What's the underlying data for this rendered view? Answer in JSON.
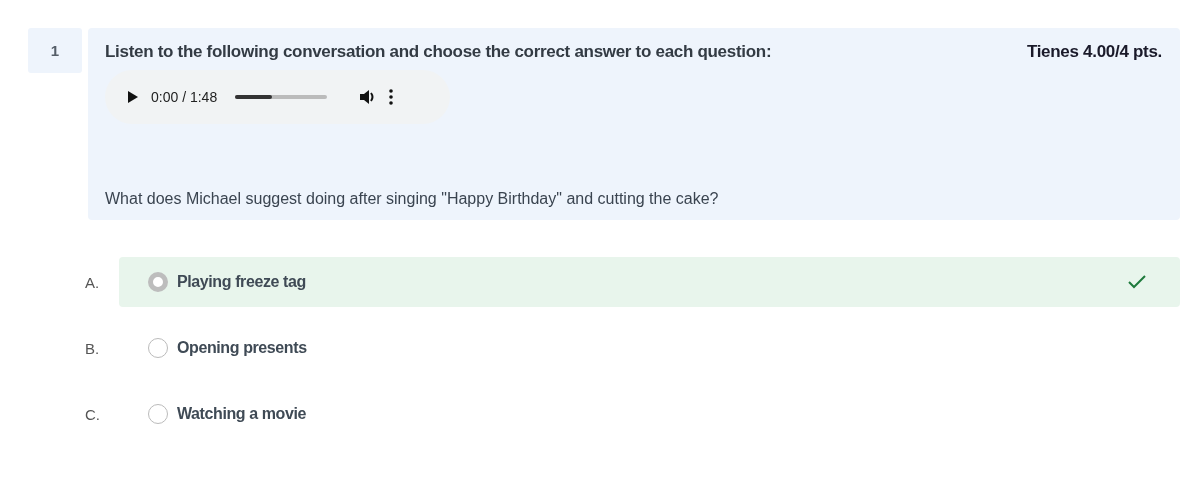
{
  "question": {
    "number": "1",
    "instruction": "Listen to the following conversation and choose the correct answer to each question:",
    "score": "Tienes 4.00/4 pts.",
    "audio": {
      "time": "0:00 / 1:48",
      "level": 0.4
    },
    "prompt": "What does Michael suggest doing after singing \"Happy Birthday\" and cutting the cake?"
  },
  "options": [
    {
      "letter": "A.",
      "text": "Playing freeze tag",
      "selected": true,
      "correct": true
    },
    {
      "letter": "B.",
      "text": "Opening presents",
      "selected": false,
      "correct": false
    },
    {
      "letter": "C.",
      "text": "Watching a movie",
      "selected": false,
      "correct": false
    }
  ]
}
